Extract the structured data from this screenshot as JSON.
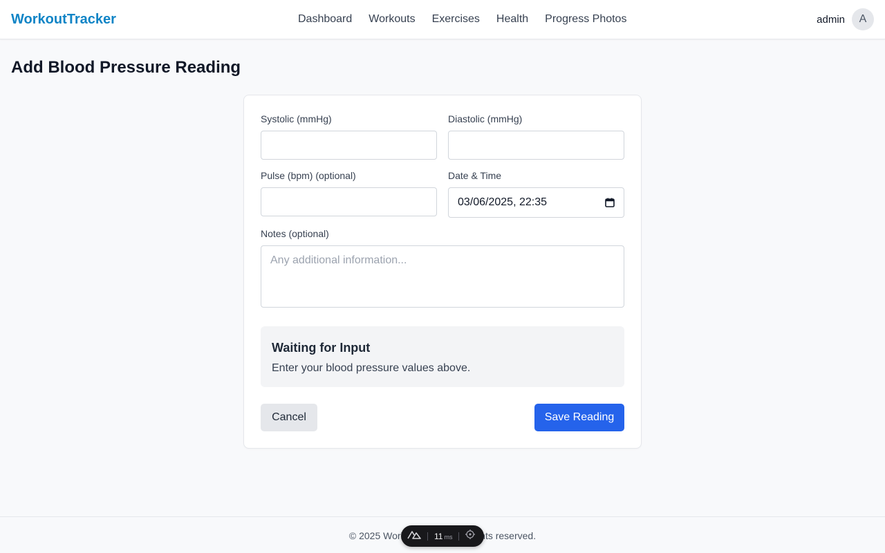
{
  "header": {
    "brand": "WorkoutTracker",
    "nav": [
      {
        "label": "Dashboard"
      },
      {
        "label": "Workouts"
      },
      {
        "label": "Exercises"
      },
      {
        "label": "Health"
      },
      {
        "label": "Progress Photos"
      }
    ],
    "username": "admin",
    "avatar_initial": "A"
  },
  "page": {
    "title": "Add Blood Pressure Reading"
  },
  "form": {
    "systolic": {
      "label": "Systolic (mmHg)",
      "value": ""
    },
    "diastolic": {
      "label": "Diastolic (mmHg)",
      "value": ""
    },
    "pulse": {
      "label": "Pulse (bpm) (optional)",
      "value": ""
    },
    "datetime": {
      "label": "Date & Time",
      "value": "03/06/2025, 22:35"
    },
    "notes": {
      "label": "Notes (optional)",
      "value": "",
      "placeholder": "Any additional information..."
    }
  },
  "status": {
    "title": "Waiting for Input",
    "message": "Enter your blood pressure values above."
  },
  "actions": {
    "cancel": "Cancel",
    "save": "Save Reading"
  },
  "footer": {
    "text": "© 2025 WorkoutTracker. All rights reserved."
  },
  "devtools": {
    "ms_value": "11",
    "ms_unit": "ms"
  }
}
